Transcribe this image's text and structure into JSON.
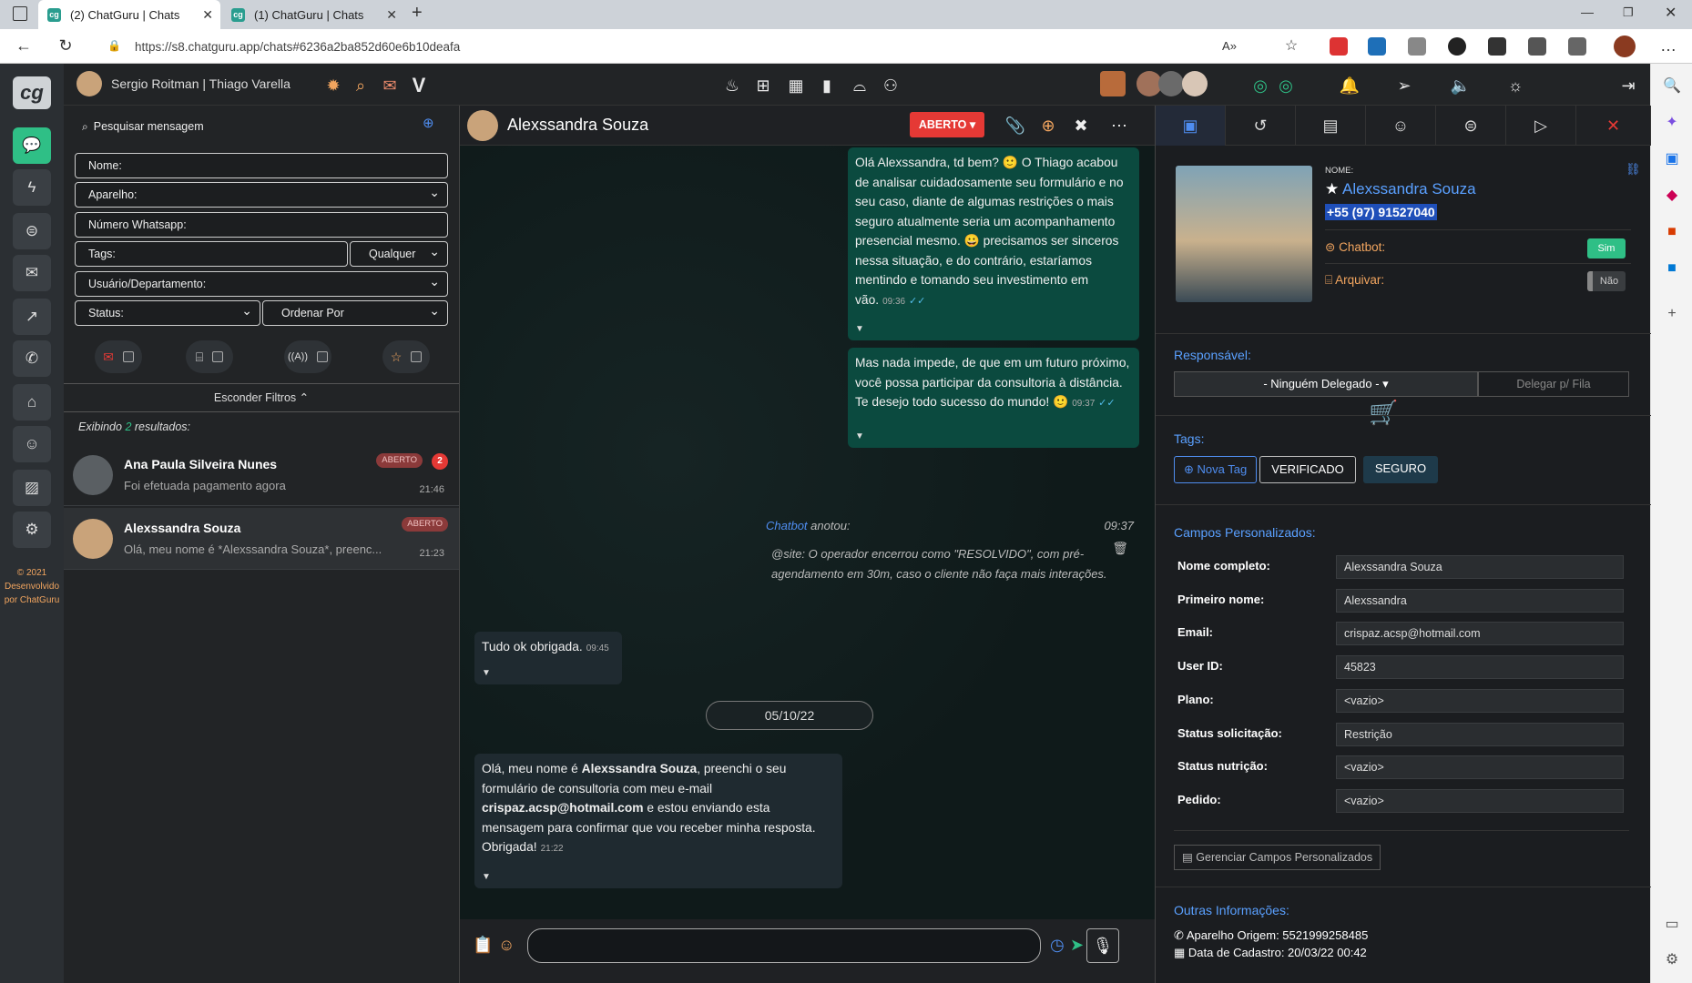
{
  "browser": {
    "tabs": [
      {
        "title": "(2) ChatGuru | Chats",
        "active": true
      },
      {
        "title": "(1) ChatGuru | Chats",
        "active": false
      }
    ],
    "url": "https://s8.chatguru.app/chats#6236a2ba852d60e6b10deafa"
  },
  "rail": {
    "logo": "cg",
    "footer": "© 2021 Desenvolvido por ChatGuru",
    "items": [
      "chats-icon",
      "bolt-icon",
      "robot-icon",
      "inbox-icon",
      "chart-icon",
      "phone-icon",
      "tag-icon",
      "user-icon",
      "image-icon",
      "gear-icon"
    ]
  },
  "topbar": {
    "user_label": "Sergio Roitman | Thiago Varella"
  },
  "left": {
    "search_placeholder": "Pesquisar mensagem",
    "fields": {
      "nome": "Nome:",
      "aparelho": "Aparelho:",
      "numero": "Número Whatsapp:",
      "tags": "Tags:",
      "qualquer": "Qualquer",
      "usuario": "Usuário/Departamento:",
      "status": "Status:",
      "ordenar": "Ordenar Por"
    },
    "hide_filters": "Esconder Filtros ⌃",
    "results_prefix": "Exibindo ",
    "results_count": "2",
    "results_suffix": " resultados:",
    "chats": [
      {
        "name": "Ana Paula Silveira Nunes",
        "preview": "Foi efetuada pagamento agora",
        "badge": "ABERTO",
        "count": "2",
        "time": "21:46"
      },
      {
        "name": "Alexssandra Souza",
        "preview": "Olá, meu nome é *Alexssandra Souza*, preenc...",
        "badge": "ABERTO",
        "time": "21:23"
      }
    ]
  },
  "chat": {
    "contact_name": "Alexssandra Souza",
    "status": "ABERTO",
    "messages": [
      {
        "id": "m1",
        "dir": "out",
        "text": "Olá Alexssandra, td bem? 🙂 O Thiago acabou de analisar cuidadosamente seu formulário e no seu caso, diante de algumas restrições o mais seguro atualmente seria um acompanhamento presencial mesmo. 😀 precisamos ser sinceros nessa situação, e do contrário, estaríamos mentindo e tomando seu investimento em vão.",
        "time": "09:36"
      },
      {
        "id": "m2",
        "dir": "out",
        "text": "Mas nada impede, de que em um futuro próximo, você possa participar da consultoria à distância. Te desejo todo sucesso do mundo! 🙂",
        "time": "09:37"
      },
      {
        "id": "m3",
        "dir": "in",
        "text": "Tudo ok obrigada.",
        "time": "09:45"
      },
      {
        "id": "m4",
        "dir": "in",
        "text_parts": [
          "Olá, meu nome é ",
          "Alexssandra Souza",
          ", preenchi o seu formulário de consultoria com meu e-mail ",
          "crispaz.acsp@hotmail.com",
          " e estou enviando esta mensagem para confirmar que vou receber minha resposta. Obrigada!"
        ],
        "time": "21:22"
      }
    ],
    "note": {
      "author": "Chatbot",
      "action": " anotou:",
      "time": "09:37",
      "text": "@site: O operador encerrou como \"RESOLVIDO\", com pré-agendamento em 30m, caso o cliente não faça mais interações."
    },
    "date_divider": "05/10/22"
  },
  "right": {
    "nome_label": "NOME:",
    "name": "Alexssandra Souza",
    "phone": "+55 (97) 91527040",
    "chatbot_label": "Chatbot:",
    "chatbot_value": "Sim",
    "arquivar_label": "Arquivar:",
    "arquivar_value": "Não",
    "responsavel_title": "Responsável:",
    "delegado": "- Ninguém Delegado - ▾",
    "delegar_fila": "Delegar p/ Fila",
    "tags_title": "Tags:",
    "nova_tag": "Nova Tag",
    "tags": [
      "VERIFICADO",
      "SEGURO"
    ],
    "campos_title": "Campos Personalizados:",
    "campos": [
      {
        "label": "Nome completo:",
        "value": "Alexssandra Souza"
      },
      {
        "label": "Primeiro nome:",
        "value": "Alexssandra"
      },
      {
        "label": "Email:",
        "value": "crispaz.acsp@hotmail.com"
      },
      {
        "label": "User ID:",
        "value": "45823"
      },
      {
        "label": "Plano:",
        "value": "<vazio>"
      },
      {
        "label": "Status solicitação:",
        "value": "Restrição"
      },
      {
        "label": "Status nutrição:",
        "value": "<vazio>"
      },
      {
        "label": "Pedido:",
        "value": "<vazio>"
      }
    ],
    "gerenciar": "Gerenciar Campos Personalizados",
    "outras_title": "Outras Informações:",
    "aparelho": "Aparelho Origem: 5521999258485",
    "cadastro": "Data de Cadastro: 20/03/22 00:42"
  }
}
